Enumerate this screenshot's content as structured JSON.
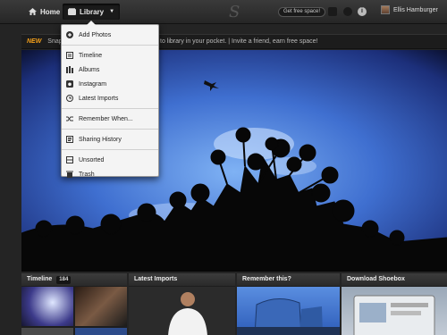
{
  "topbar": {
    "home_label": "Home",
    "library_label": "Library",
    "logo_text": "S",
    "free_space_label": "Get free space!",
    "user_name": "Ellis Hamburger"
  },
  "notice": {
    "badge": "NEW",
    "text_left": "Snapjoy",
    "text_right": "to library in your pocket.  |  Invite a friend, earn free space!"
  },
  "menu": {
    "add_photos": "Add Photos",
    "timeline": "Timeline",
    "albums": "Albums",
    "instagram": "Instagram",
    "latest_imports": "Latest Imports",
    "remember_when": "Remember When...",
    "sharing_history": "Sharing History",
    "unsorted": "Unsorted",
    "trash": "Trash"
  },
  "panels": {
    "timeline": {
      "title": "Timeline",
      "count": "184"
    },
    "latest_imports": {
      "title": "Latest Imports"
    },
    "remember": {
      "title": "Remember this?"
    },
    "download": {
      "title": "Download Shoebox"
    }
  },
  "colors": {
    "accent": "#f7a21b",
    "sky": "#3f6fd0"
  }
}
